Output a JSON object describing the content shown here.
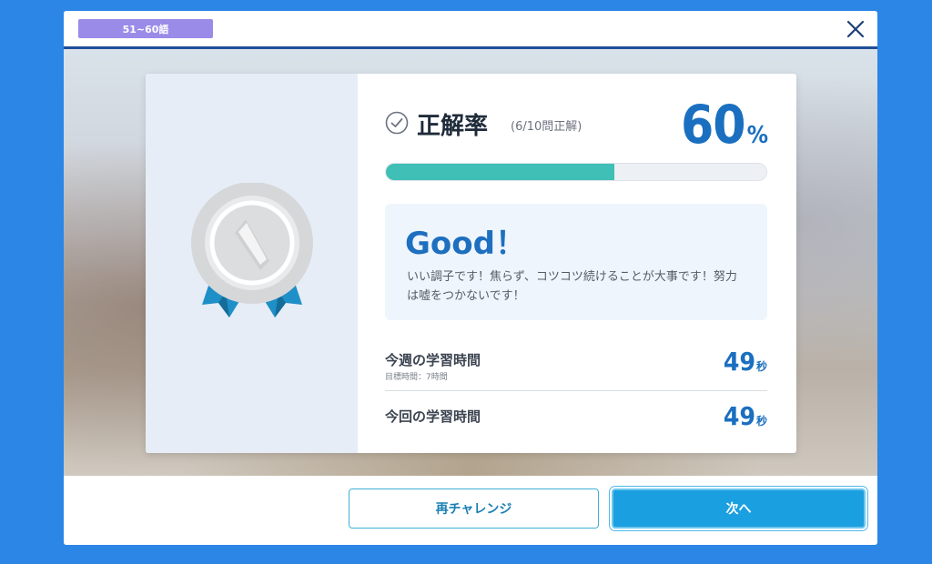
{
  "header": {
    "range_label": "51~60語",
    "close_icon": "close-icon"
  },
  "result": {
    "score_title": "正解率",
    "score_detail": "(6/10問正解)",
    "accuracy_value": "60",
    "accuracy_unit": "%",
    "progress_fraction": 0.6,
    "progress_color": "#3fbfb5",
    "feedback_title": "Good！",
    "feedback_message": "いい調子です！焦らず、コツコツ続けることが大事です！努力は嘘をつかないです！",
    "medal_icon": "silver-medal-icon",
    "check_icon": "check-circle-icon"
  },
  "stats": {
    "weekly_label": "今週の学習時間",
    "weekly_goal": "目標時間：7時間",
    "weekly_value": "49",
    "weekly_unit": "秒",
    "session_label": "今回の学習時間",
    "session_value": "49",
    "session_unit": "秒"
  },
  "footer": {
    "retry_label": "再チャレンジ",
    "next_label": "次へ"
  },
  "colors": {
    "background": "#2b86e6",
    "accent_blue": "#1a6fc0",
    "badge_purple": "#9b8be8",
    "button_blue": "#1a9fe0"
  }
}
